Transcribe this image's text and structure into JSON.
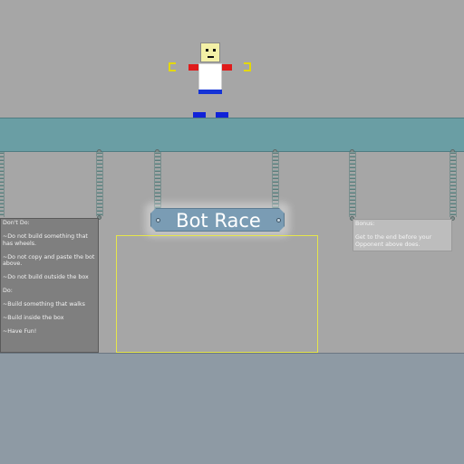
{
  "title_sign": {
    "text": "Bot Race"
  },
  "rules_sign": {
    "lines": [
      "Don't Do:",
      "~Do not build something that has wheels.",
      "~Do not copy and paste the bot above.",
      "~Do not build outside the box",
      "Do:",
      "~Build something that walks",
      "~Build inside the box",
      "~Have Fun!"
    ]
  },
  "bonus_sign": {
    "heading": "Bonus:",
    "text": "Get to the end before your Opponent above does."
  },
  "colors": {
    "background": "#a6a6a6",
    "beam": "#6a9ea4",
    "lower_floor": "#8e9aa4",
    "build_zone_outline": "#e6e64a",
    "robot_head": "#f3f0a6",
    "robot_arms": "#e01a1a",
    "robot_feet": "#1022d8"
  }
}
